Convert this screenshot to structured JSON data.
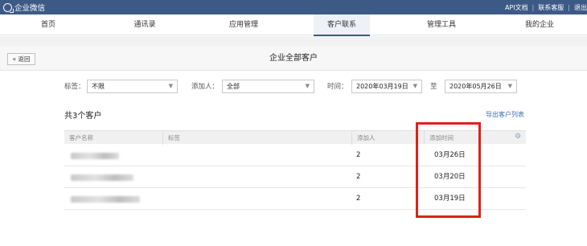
{
  "header": {
    "app_title": "企业微信",
    "links": [
      "API文档",
      "联系客服",
      "退出"
    ]
  },
  "nav": {
    "items": [
      "首页",
      "通讯录",
      "应用管理",
      "客户联系",
      "管理工具",
      "我的企业"
    ],
    "active": "客户联系"
  },
  "page": {
    "back_label": "« 返回",
    "title": "企业全部客户"
  },
  "filters": {
    "tag_label": "标签：",
    "tag_value": "不限",
    "adder_label": "添加人：",
    "adder_value": "全部",
    "time_label": "时间：",
    "time_from": "2020年03月19日",
    "time_to_label": "至",
    "time_to": "2020年05月26日",
    "caret": "▼"
  },
  "summary": {
    "count_text": "共3个客户",
    "export_label": "导出客户列表"
  },
  "table": {
    "columns": [
      "客户名称",
      "标签",
      "添加人",
      "添加时间"
    ],
    "settings_icon": "gear-icon",
    "rows": [
      {
        "adder": "2",
        "added_time": "03月26日"
      },
      {
        "adder": "2",
        "added_time": "03月20日"
      },
      {
        "adder": "2",
        "added_time": "03月19日"
      }
    ]
  },
  "colors": {
    "topbar": "#3d5a86",
    "link": "#3d6fb5",
    "highlight": "#e0201a"
  }
}
